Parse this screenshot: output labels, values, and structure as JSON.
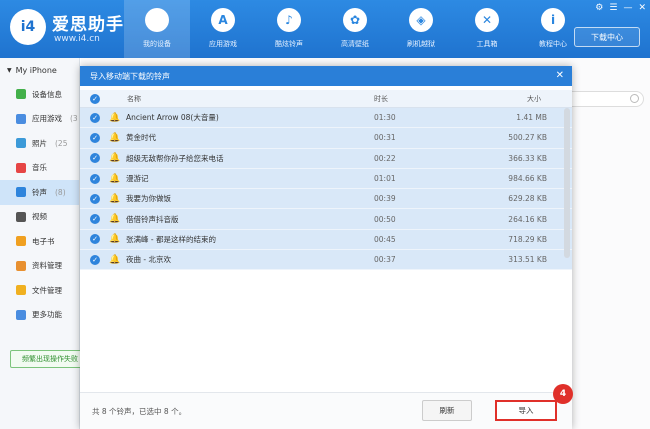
{
  "header": {
    "brand": "爱思助手",
    "url": "www.i4.cn",
    "logo_text": "i4",
    "nav": [
      {
        "label": "我的设备",
        "icon": "apple-icon",
        "glyph": "",
        "active": true
      },
      {
        "label": "应用游戏",
        "icon": "app-store-icon",
        "glyph": "A"
      },
      {
        "label": "酷炫铃声",
        "icon": "bell-icon",
        "glyph": "♪"
      },
      {
        "label": "高清壁纸",
        "icon": "wallpaper-icon",
        "glyph": "✿"
      },
      {
        "label": "刷机越狱",
        "icon": "box-icon",
        "glyph": "◈"
      },
      {
        "label": "工具箱",
        "icon": "tools-icon",
        "glyph": "✕"
      },
      {
        "label": "教程中心",
        "icon": "info-icon",
        "glyph": "i"
      }
    ],
    "download_label": "下载中心"
  },
  "sidebar": {
    "device": "My iPhone",
    "items": [
      {
        "label": "设备信息",
        "count": "",
        "color": "#43b04a",
        "icon": "device-info-icon"
      },
      {
        "label": "应用游戏",
        "count": "(3",
        "color": "#4a8de0",
        "icon": "apps-icon"
      },
      {
        "label": "照片",
        "count": "(25",
        "color": "#3c9ad8",
        "icon": "photos-icon"
      },
      {
        "label": "音乐",
        "count": "",
        "color": "#e64545",
        "icon": "music-icon"
      },
      {
        "label": "铃声",
        "count": "(8)",
        "color": "#2e84dc",
        "icon": "ringtone-icon",
        "active": true
      },
      {
        "label": "视频",
        "count": "",
        "color": "#555555",
        "icon": "video-icon"
      },
      {
        "label": "电子书",
        "count": "",
        "color": "#f0a020",
        "icon": "ebook-icon"
      },
      {
        "label": "资料管理",
        "count": "",
        "color": "#e89030",
        "icon": "data-icon"
      },
      {
        "label": "文件管理",
        "count": "",
        "color": "#f0b020",
        "icon": "file-icon"
      },
      {
        "label": "更多功能",
        "count": "",
        "color": "#4a8de0",
        "icon": "more-icon"
      }
    ],
    "feedback_label": "频繁出现操作失败"
  },
  "dialog": {
    "title": "导入移动端下载的铃声",
    "close": "✕",
    "col_name": "名称",
    "col_duration": "时长",
    "col_size": "大小",
    "rows": [
      {
        "name": "Ancient Arrow 08(大音量)",
        "duration": "01:30",
        "size": "1.41 MB"
      },
      {
        "name": "黄金时代",
        "duration": "00:31",
        "size": "500.27 KB"
      },
      {
        "name": "超级无敌帮你孙子给您来电话",
        "duration": "00:22",
        "size": "366.33 KB"
      },
      {
        "name": "漫游记",
        "duration": "01:01",
        "size": "984.66 KB"
      },
      {
        "name": "我要为你做饭",
        "duration": "00:39",
        "size": "629.28 KB"
      },
      {
        "name": "借借铃声抖音版",
        "duration": "00:50",
        "size": "264.16 KB"
      },
      {
        "name": "张满峰 - 都是这样的结束的",
        "duration": "00:45",
        "size": "718.29 KB"
      },
      {
        "name": "夜曲 - 北京欢",
        "duration": "00:37",
        "size": "313.51 KB"
      }
    ],
    "count_text": "共 8 个铃声，已选中 8 个。",
    "refresh_label": "刷新",
    "import_label": "导入",
    "step_badge": "4"
  }
}
